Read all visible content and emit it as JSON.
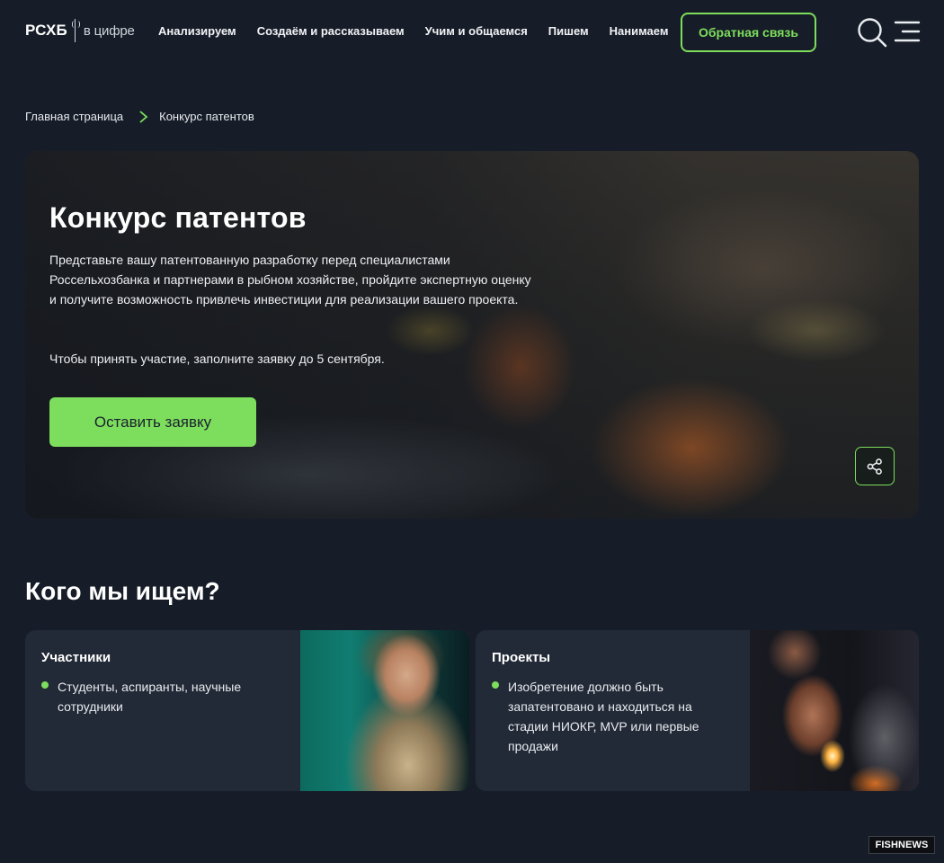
{
  "header": {
    "logo_brand": "РСХБ",
    "logo_sub": "в цифре",
    "nav": [
      {
        "label": "Анализируем"
      },
      {
        "label": "Создаём и рассказываем"
      },
      {
        "label": "Учим и общаемся"
      },
      {
        "label": "Пишем"
      },
      {
        "label": "Нанимаем"
      }
    ],
    "feedback_label": "Обратная связь",
    "accent": "#7ddd5c"
  },
  "breadcrumb": {
    "home": "Главная страница",
    "current": "Конкурс патентов"
  },
  "hero": {
    "title": "Конкурс патентов",
    "text": "Представьте вашу патентованную разработку перед специалистами Россельхозбанка и партнерами в рыбном хозяйстве, пройдите экспертную оценку и получите возможность привлечь инвестиции для реализации вашего проекта.",
    "text2": "Чтобы принять участие, заполните заявку до 5 сентября.",
    "apply_label": "Оставить заявку"
  },
  "section": {
    "title": "Кого мы ищем?",
    "cards": [
      {
        "title": "Участники",
        "items": [
          "Студенты, аспиранты, научные сотрудники"
        ]
      },
      {
        "title": "Проекты",
        "items": [
          "Изобретение должно быть запатентовано и находиться на стадии НИОКР, MVP или первые продажи"
        ]
      }
    ]
  },
  "watermark": {
    "part1": "FISH",
    "part2": "NEWS"
  }
}
